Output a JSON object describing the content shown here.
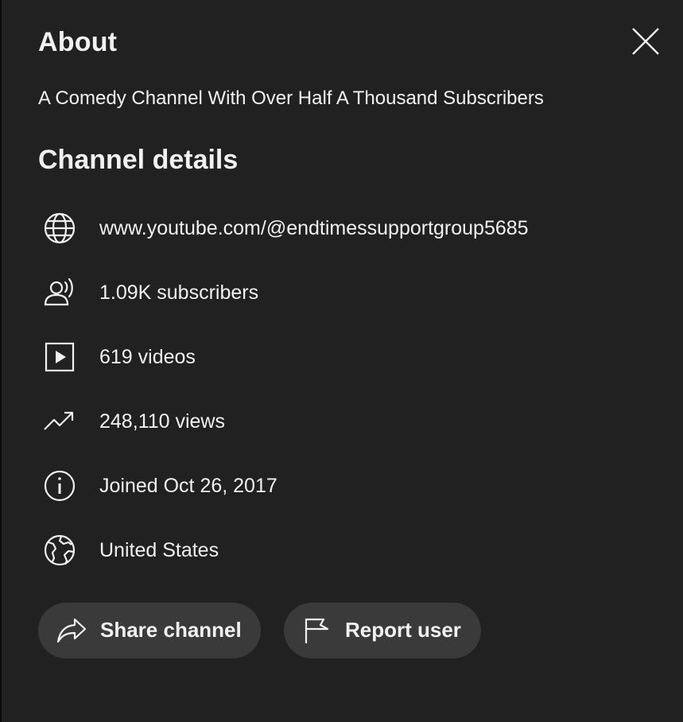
{
  "dialog": {
    "title": "About",
    "description": "A Comedy Channel With Over Half A Thousand Subscribers",
    "section_title": "Channel details"
  },
  "details": [
    {
      "icon": "globe-icon",
      "text": "www.youtube.com/@endtimessupportgroup5685"
    },
    {
      "icon": "subscribers-icon",
      "text": "1.09K subscribers"
    },
    {
      "icon": "video-play-icon",
      "text": "619 videos"
    },
    {
      "icon": "trending-icon",
      "text": "248,110 views"
    },
    {
      "icon": "info-icon",
      "text": "Joined Oct 26, 2017"
    },
    {
      "icon": "earth-icon",
      "text": "United States"
    }
  ],
  "buttons": {
    "share_label": "Share channel",
    "report_label": "Report user"
  },
  "colors": {
    "dialog_background": "#212121",
    "button_background": "#3a3a3a",
    "text": "#f1f1f1"
  }
}
